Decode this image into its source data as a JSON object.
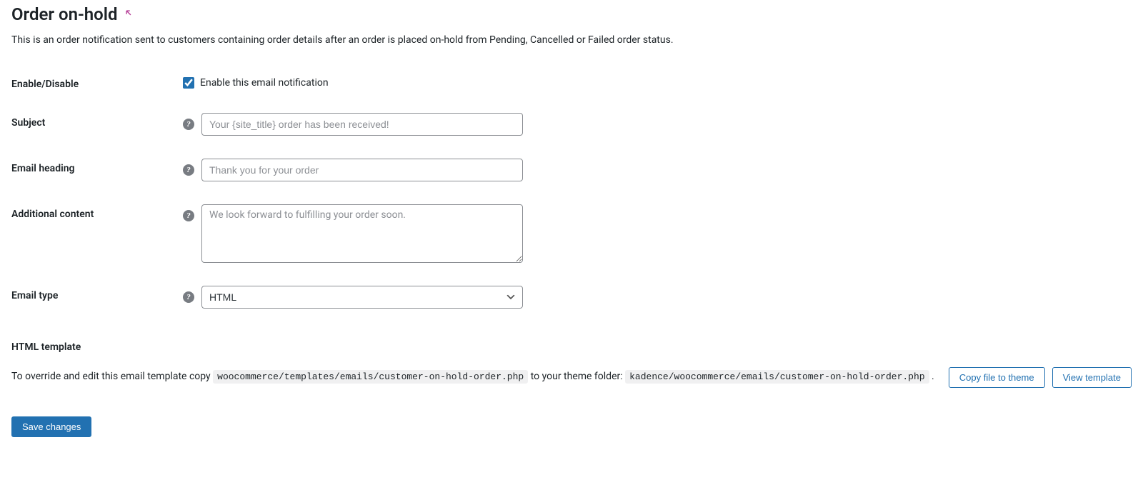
{
  "header": {
    "title": "Order on-hold"
  },
  "description": "This is an order notification sent to customers containing order details after an order is placed on-hold from Pending, Cancelled or Failed order status.",
  "form": {
    "enable_label": "Enable/Disable",
    "enable_checkbox_label": "Enable this email notification",
    "subject_label": "Subject",
    "subject_placeholder": "Your {site_title} order has been received!",
    "heading_label": "Email heading",
    "heading_placeholder": "Thank you for your order",
    "additional_label": "Additional content",
    "additional_placeholder": "We look forward to fulfilling your order soon.",
    "type_label": "Email type",
    "type_value": "HTML"
  },
  "template": {
    "section_title": "HTML template",
    "text_prefix": "To override and edit this email template copy ",
    "code_source": "woocommerce/templates/emails/customer-on-hold-order.php",
    "text_middle": " to your theme folder: ",
    "code_dest": "kadence/woocommerce/emails/customer-on-hold-order.php",
    "text_suffix": " .",
    "copy_button": "Copy file to theme",
    "view_button": "View template"
  },
  "save_button": "Save changes"
}
